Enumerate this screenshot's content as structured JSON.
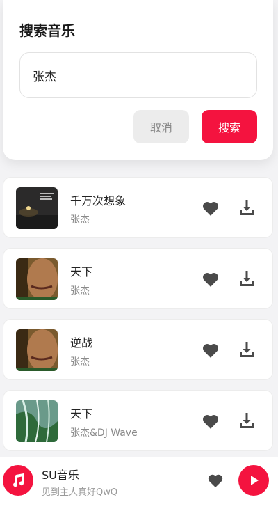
{
  "search": {
    "title": "搜索音乐",
    "query": "张杰",
    "cancel_label": "取消",
    "search_label": "搜索"
  },
  "songs": [
    {
      "title": "千万次想象",
      "artist": "张杰",
      "cover": "dark-lamp-cover"
    },
    {
      "title": "天下",
      "artist": "张杰",
      "cover": "portrait-cover"
    },
    {
      "title": "逆战",
      "artist": "张杰",
      "cover": "portrait-cover"
    },
    {
      "title": "天下",
      "artist": "张杰&DJ Wave",
      "cover": "waterfall-cover"
    }
  ],
  "player": {
    "title": "SU音乐",
    "subtitle": "见到主人真好QwQ"
  },
  "colors": {
    "accent": "#f4133f",
    "icon": "#4a4a4a"
  }
}
